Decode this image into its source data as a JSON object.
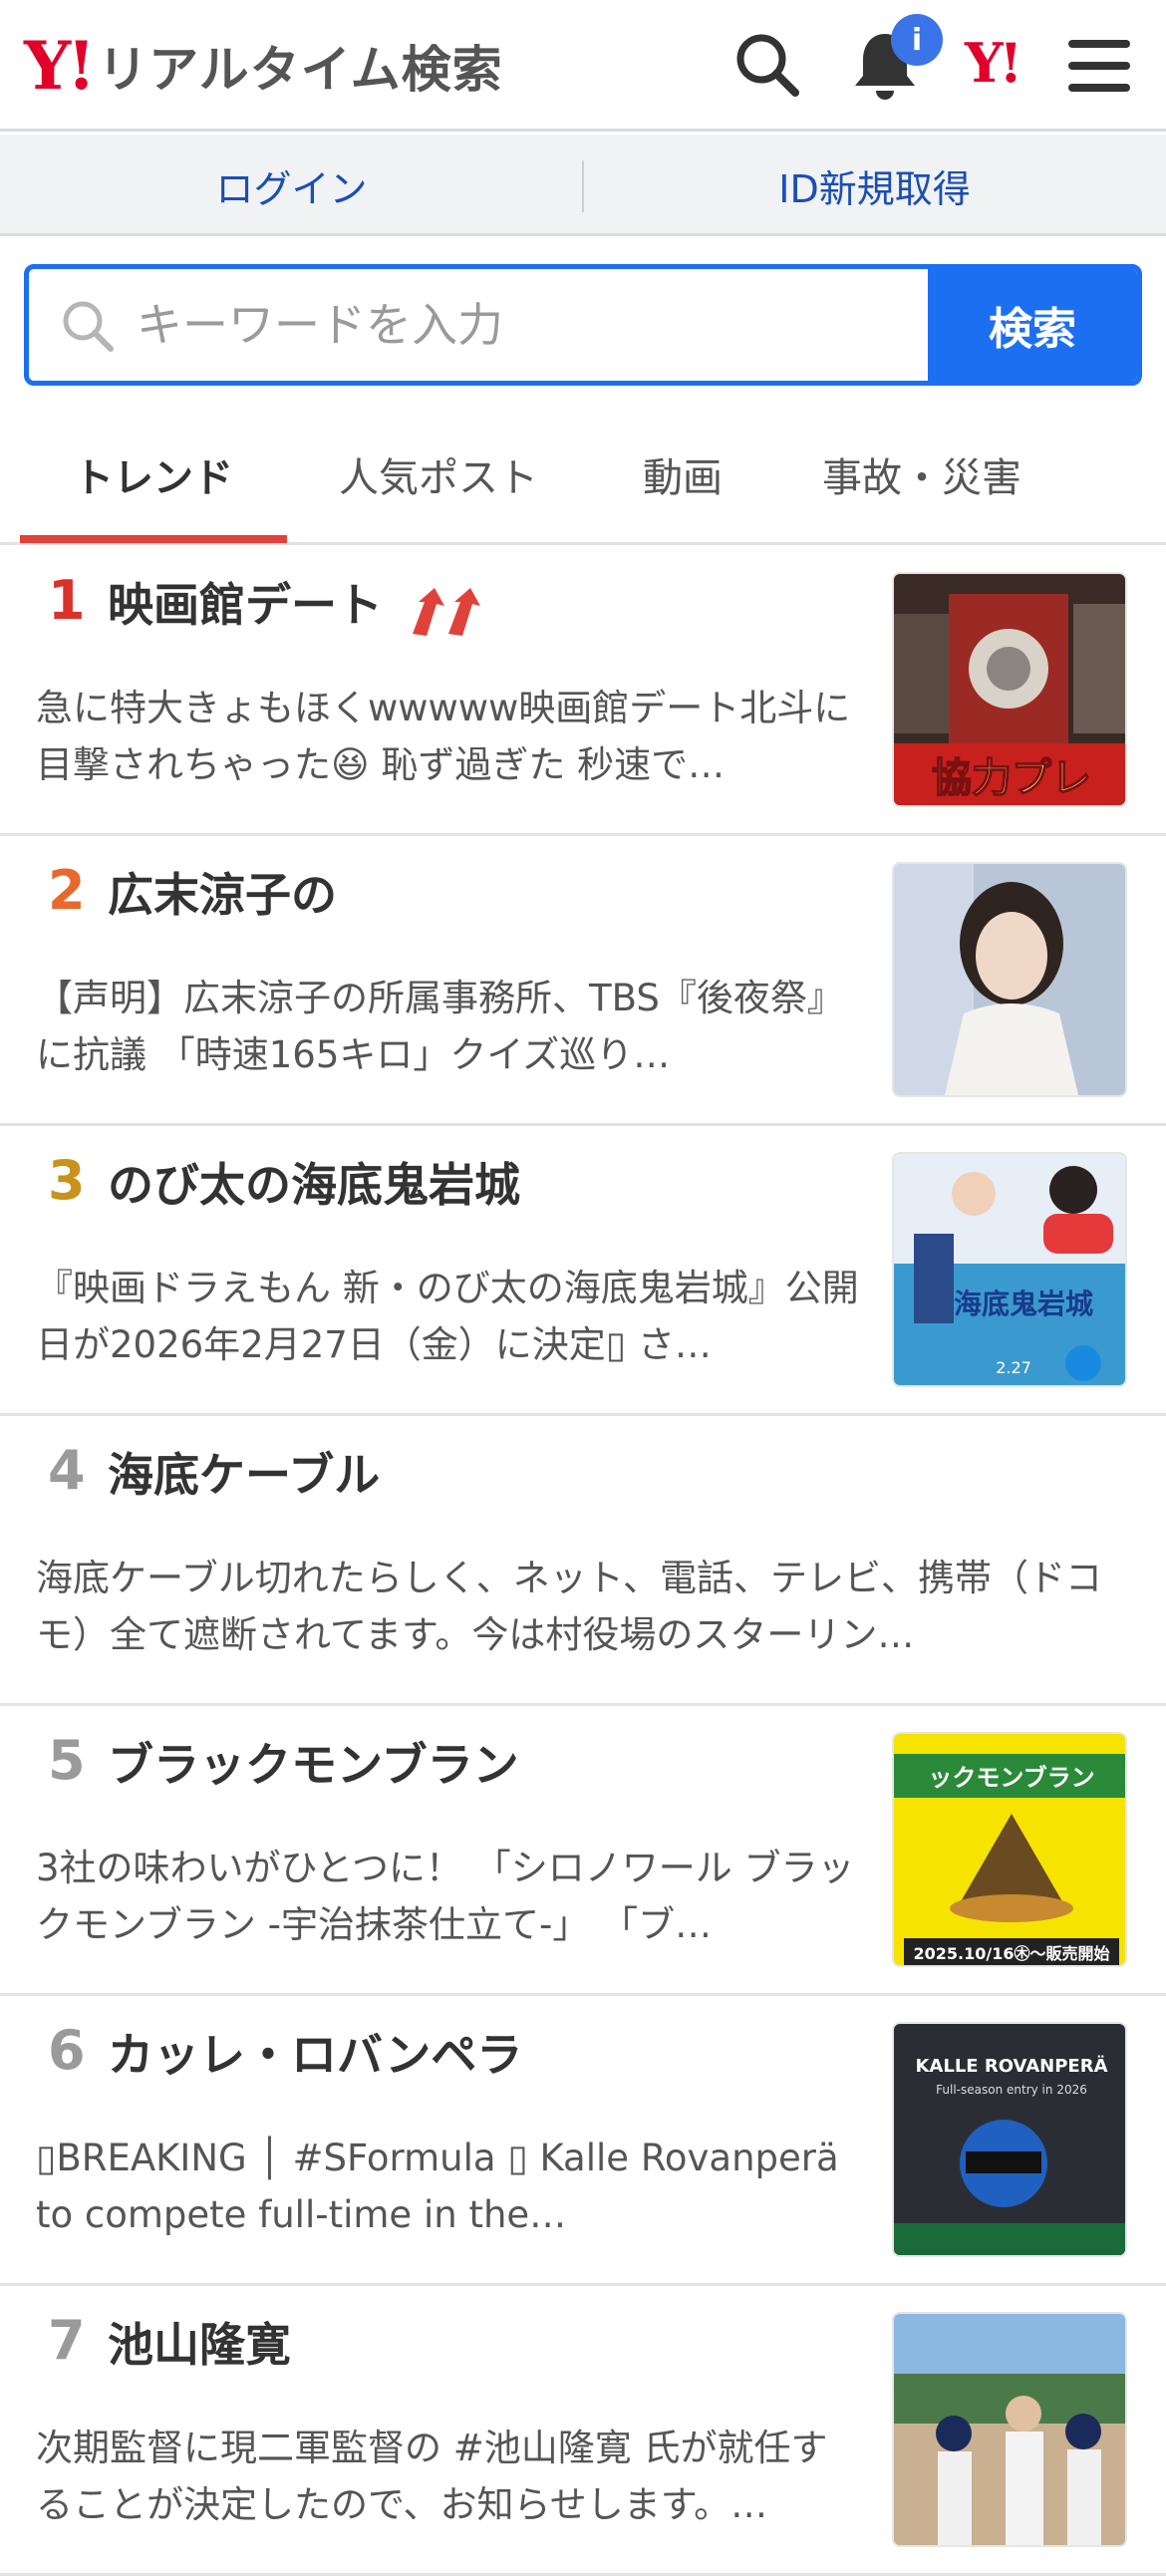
{
  "header": {
    "logo_mark": "Y!",
    "logo_text": "リアルタイム検索",
    "notification_badge": "i",
    "yahoo_mark": "Y!"
  },
  "login_bar": {
    "login_label": "ログイン",
    "signup_label": "ID新規取得"
  },
  "search": {
    "placeholder": "キーワードを入力",
    "value": "",
    "button_label": "検索"
  },
  "tabs": [
    {
      "label": "トレンド",
      "active": true
    },
    {
      "label": "人気ポスト",
      "active": false
    },
    {
      "label": "動画",
      "active": false
    },
    {
      "label": "事故・災害",
      "active": false
    }
  ],
  "colors": {
    "rank1": "#d9322b",
    "rank2": "#e8692d",
    "rank3": "#c9921a",
    "rank_other": "#9a9a9a",
    "accent_blue": "#1d6ff2"
  },
  "trends": [
    {
      "rank": "1",
      "title": "映画館デート",
      "rising": true,
      "snippet": "急に特大きょもほくwwwww映画館デート北斗に目撃されちゃった😆 恥ず過ぎた 秒速で…",
      "thumb": "variety-show-thumbnail"
    },
    {
      "rank": "2",
      "title": "広末涼子の",
      "rising": false,
      "snippet": "【声明】広末涼子の所属事務所、TBS『後夜祭』に抗議 「時速165キロ」クイズ巡り…",
      "thumb": "portrait-thumbnail"
    },
    {
      "rank": "3",
      "title": "のび太の海底鬼岩城",
      "rising": false,
      "snippet": "『映画ドラえもん 新・のび太の海底鬼岩城』公開日が2026年2月27日（金）に決定▯ さ…",
      "thumb": "movie-poster-thumbnail"
    },
    {
      "rank": "4",
      "title": "海底ケーブル",
      "rising": false,
      "snippet": "海底ケーブル切れたらしく、ネット、電話、テレビ、携帯（ドコモ）全て遮断されてます。今は村役場のスターリン…",
      "thumb": null
    },
    {
      "rank": "5",
      "title": "ブラックモンブラン",
      "rising": false,
      "snippet": "3社の味わいがひとつに！ 「シロノワール ブラックモンブラン -宇治抹茶仕立て-」 「ブ…",
      "thumb": "dessert-ad-thumbnail"
    },
    {
      "rank": "6",
      "title": "カッレ・ロバンペラ",
      "rising": false,
      "snippet": "▯BREAKING │ #SFormula ▯ Kalle Rovanperä to compete full-time in the…",
      "thumb": "racing-driver-thumbnail"
    },
    {
      "rank": "7",
      "title": "池山隆寛",
      "rising": false,
      "snippet": "次期監督に現二軍監督の #池山隆寛 氏が就任することが決定したので、お知らせします。…",
      "thumb": "baseball-thumbnail"
    }
  ],
  "thumb_text": {
    "t1_caption": "協力プレ",
    "t3_caption": "海底鬼岩城",
    "t3_date": "2.27",
    "t5_title": "ックモンブラン",
    "t5_date": "2025.10/16㊍～販売開始",
    "t6_title": "KALLE ROVANPERÄ",
    "t6_sub": "Full-season entry in 2026"
  }
}
